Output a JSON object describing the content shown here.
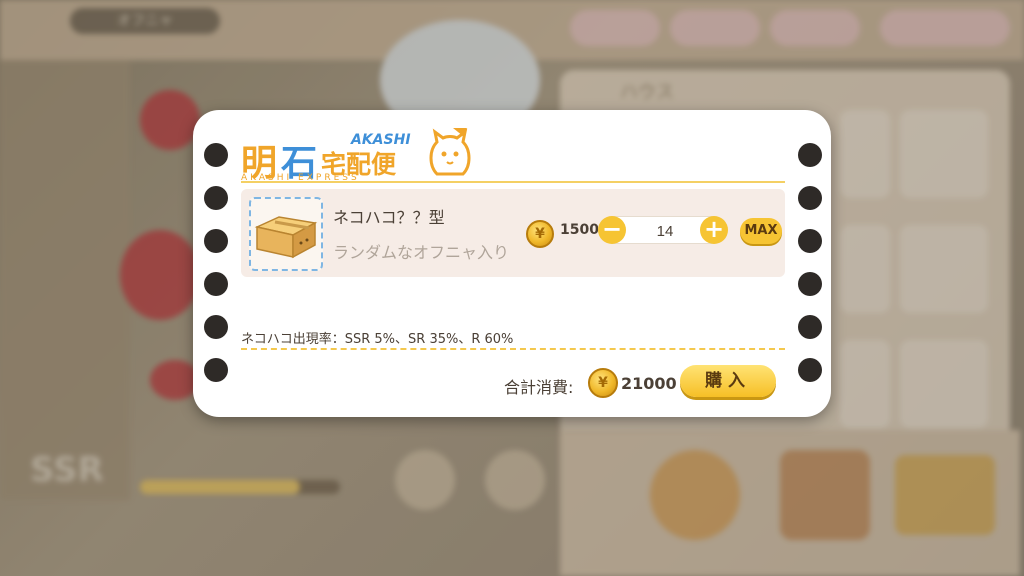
{
  "background": {
    "tag": "オフニャ",
    "panel_title": "ハウス",
    "badge": "SSR"
  },
  "dialog": {
    "logo": {
      "kanji_1": "明",
      "kanji_2": "石",
      "kanji_rest": "宅配便",
      "romaji": "AKASHI",
      "subtitle": "AKASHI EXPRESS"
    },
    "item": {
      "name": "ネコハコ？？型",
      "description": "ランダムなオフニャ入り",
      "price": "1500",
      "quantity": "14",
      "minus": "−",
      "plus": "+",
      "max_label": "MAX"
    },
    "rate_text": "ネコハコ出現率：SSR 5%、SR 35%、R 60%",
    "total_label": "合計消費:",
    "total_value": "21000",
    "buy_label": "購入"
  },
  "colors": {
    "accent_yellow": "#f6c433",
    "logo_orange": "#f0a52a",
    "logo_blue": "#3e8fd8",
    "row_bg": "#f6ece6"
  }
}
